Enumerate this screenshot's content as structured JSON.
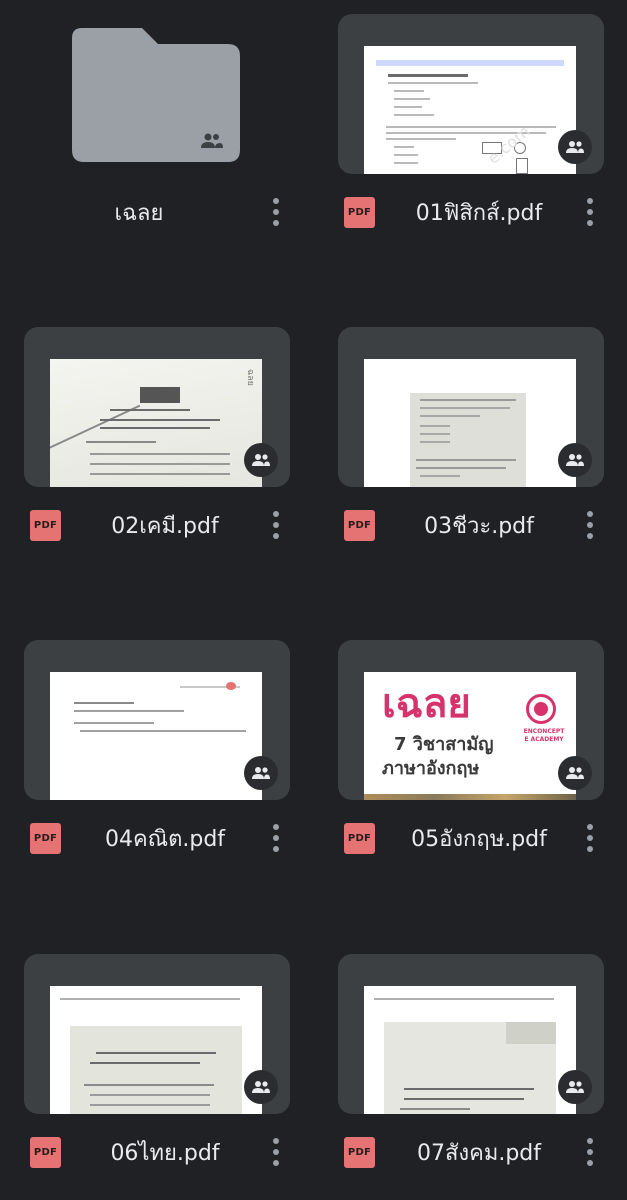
{
  "items": [
    {
      "name": "เฉลย",
      "type": "folder",
      "shared": true,
      "icons": {
        "main": "folder-icon",
        "shared": "shared-people-icon",
        "menu": "more-vert-icon"
      }
    },
    {
      "name": "01ฟิสิกส์.pdf",
      "type": "pdf",
      "shared": true
    },
    {
      "name": "02เคมี.pdf",
      "type": "pdf",
      "shared": true
    },
    {
      "name": "03ชีวะ.pdf",
      "type": "pdf",
      "shared": true
    },
    {
      "name": "04คณิต.pdf",
      "type": "pdf",
      "shared": true
    },
    {
      "name": "05อังกฤษ.pdf",
      "type": "pdf",
      "shared": true
    },
    {
      "name": "06ไทย.pdf",
      "type": "pdf",
      "shared": true
    },
    {
      "name": "07สังคม.pdf",
      "type": "pdf",
      "shared": true
    }
  ],
  "badge_label": "PDF",
  "thumb_05": {
    "headline": "เฉลย",
    "line1": "7 วิชาสามัญ",
    "line2": "ภาษาอังกฤษ",
    "logo_text1": "ENCONCEPT",
    "logo_text2": "E ACADEMY"
  },
  "colors": {
    "background": "#202124",
    "card": "#3c4043",
    "pdf_badge": "#e57373",
    "accent_pink": "#d6336c"
  }
}
